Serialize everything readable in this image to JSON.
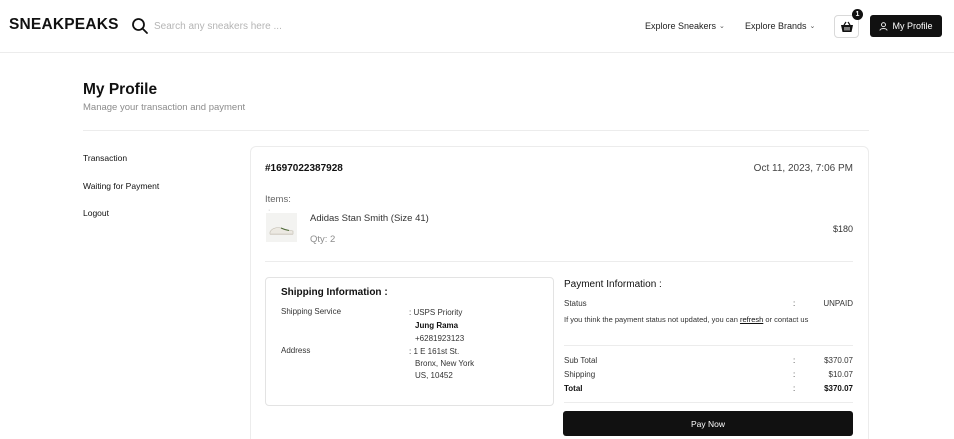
{
  "header": {
    "brand": "SNEAKPEAKS",
    "search_placeholder": "Search any sneakers here ...",
    "nav": [
      {
        "label": "Explore Sneakers"
      },
      {
        "label": "Explore Brands"
      }
    ],
    "cart_count": "1",
    "profile_label": "My Profile"
  },
  "page": {
    "title": "My Profile",
    "subtitle": "Manage your transaction and payment"
  },
  "sidebar": {
    "items": [
      {
        "label": "Transaction"
      },
      {
        "label": "Waiting for Payment"
      },
      {
        "label": "Logout"
      }
    ]
  },
  "order": {
    "id": "#1697022387928",
    "date": "Oct 11, 2023, 7:06 PM",
    "items_label": "Items:",
    "item": {
      "name": "Adidas Stan Smith (Size 41)",
      "qty": "Qty: 2",
      "price": "$180"
    },
    "shipping": {
      "title": "Shipping Information :",
      "service_label": "Shipping Service",
      "service_value": ": USPS Priority",
      "name": "Jung Rama",
      "phone": "+6281923123",
      "address_label": "Address",
      "address_line1": ": 1 E 161st St.",
      "address_line2": "Bronx, New York",
      "address_line3": "US, 10452"
    },
    "payment": {
      "title": "Payment Information :",
      "status_label": "Status",
      "status_value": "UNPAID",
      "note_before": "If you think the payment status not updated, you can",
      "note_link": "refresh",
      "note_after": "or contact us",
      "subtotal_label": "Sub Total",
      "subtotal_value": "$370.07",
      "shipping_label": "Shipping",
      "shipping_value": "$10.07",
      "total_label": "Total",
      "total_value": "$370.07",
      "colon": ":",
      "pay_button": "Pay Now"
    }
  }
}
